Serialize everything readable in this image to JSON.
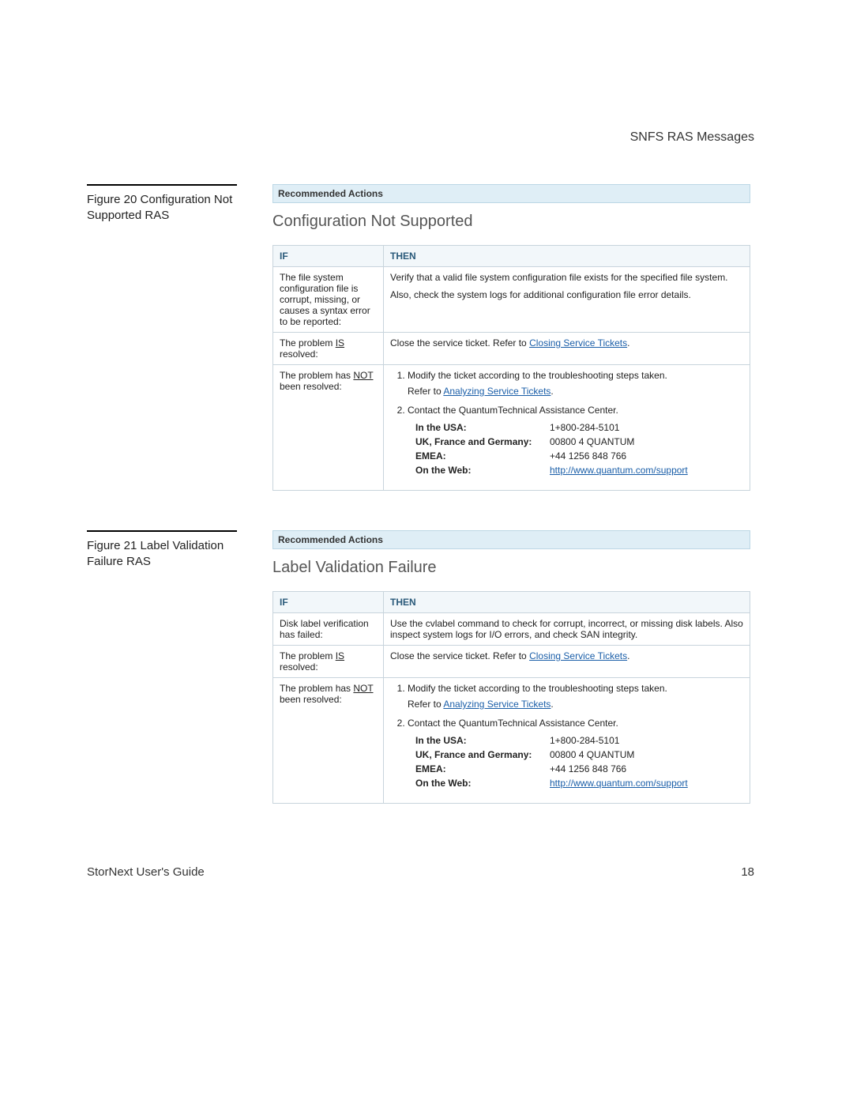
{
  "header": {
    "section": "SNFS RAS Messages"
  },
  "footer": {
    "guide": "StorNext User's Guide",
    "page": "18"
  },
  "common": {
    "recommended_actions": "Recommended Actions",
    "th_if": "IF",
    "th_then": "THEN",
    "is_resolved_pre": "The problem ",
    "is_word": "IS",
    "is_resolved_post": " resolved:",
    "close_ticket_pre": "Close the service ticket. Refer to ",
    "closing_link": "Closing Service Tickets",
    "close_ticket_post": ".",
    "not_resolved_pre": "The problem has ",
    "not_word": "NOT",
    "not_resolved_post": " been resolved:",
    "step1": "Modify the ticket according to the troubleshooting steps taken.",
    "refer_to": "Refer to ",
    "analyzing_link": "Analyzing Service Tickets",
    "refer_post": ".",
    "step2": "Contact the QuantumTechnical Assistance Center.",
    "c_usa_l": "In the USA:",
    "c_usa_v": "1+800-284-5101",
    "c_uk_l": "UK, France and Germany:",
    "c_uk_v": "00800 4 QUANTUM",
    "c_emea_l": "EMEA:",
    "c_emea_v": "+44 1256 848 766",
    "c_web_l": "On the Web:",
    "c_web_v": "http://www.quantum.com/support"
  },
  "fig20": {
    "caption": "Figure 20  Configuration Not Supported RAS",
    "title": "Configuration Not Supported",
    "row1_if": "The file system configuration file is corrupt, missing, or causes a syntax error to be reported:",
    "row1_then_a": "Verify that a valid file system configuration file exists for the specified file system.",
    "row1_then_b": "Also, check the system logs for additional configuration file error details."
  },
  "fig21": {
    "caption": "Figure 21  Label Validation Failure RAS",
    "title": "Label Validation Failure",
    "row1_if": "Disk label verification has failed:",
    "row1_then": "Use the cvlabel command to check for corrupt, incorrect, or missing disk labels. Also inspect system logs for I/O errors, and check SAN integrity."
  }
}
